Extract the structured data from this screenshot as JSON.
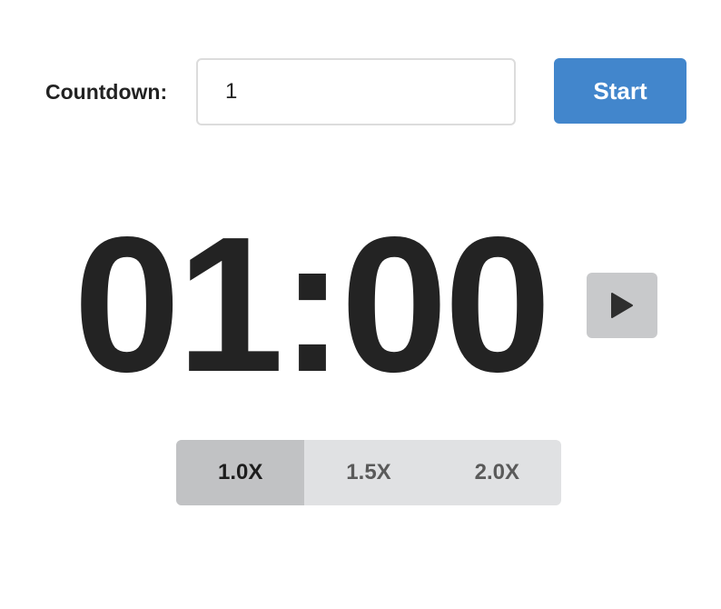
{
  "countdown": {
    "label": "Countdown:",
    "value": "1",
    "placeholder": ""
  },
  "start_button": {
    "label": "Start",
    "color": "#4286cc"
  },
  "timer": {
    "display": "01:00"
  },
  "play_button": {
    "icon": "play-icon"
  },
  "speed_options": {
    "selected": "1.0X",
    "items": [
      {
        "label": "1.0X"
      },
      {
        "label": "1.5X"
      },
      {
        "label": "2.0X"
      }
    ]
  }
}
